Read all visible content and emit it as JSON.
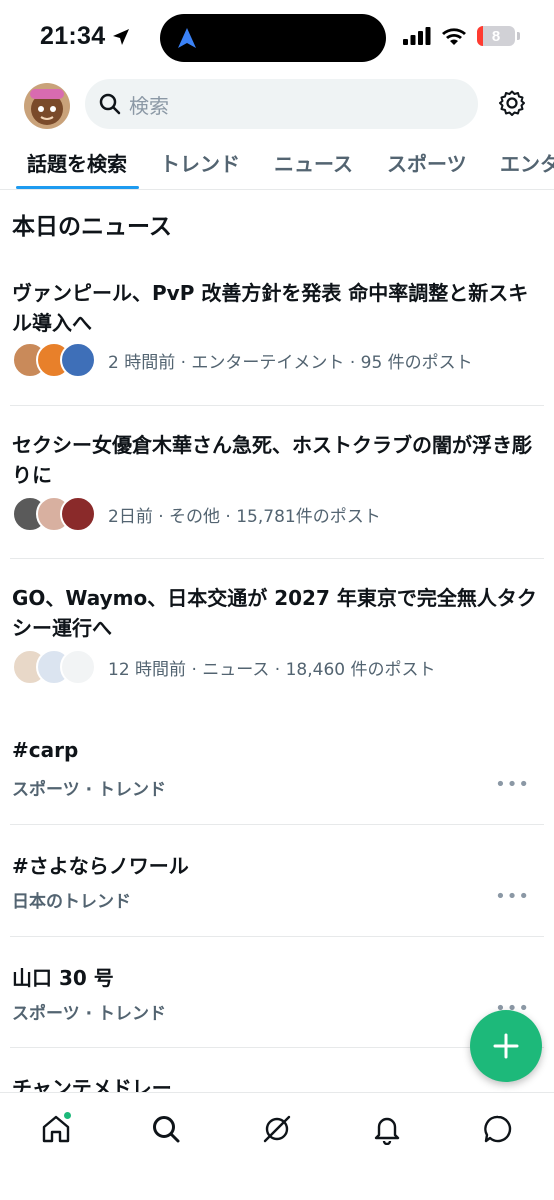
{
  "status": {
    "time": "21:34",
    "battery": "8"
  },
  "search": {
    "placeholder": "検索"
  },
  "tabs": [
    {
      "label": "話題を検索"
    },
    {
      "label": "トレンド"
    },
    {
      "label": "ニュース"
    },
    {
      "label": "スポーツ"
    },
    {
      "label": "エンタ"
    }
  ],
  "section": {
    "title": "本日のニュース"
  },
  "news": [
    {
      "headline": "ヴァンピール、PvP 改善方針を発表 命中率調整と新スキル導入へ",
      "meta": "2 時間前 · エンターテイメント · 95 件のポスト"
    },
    {
      "headline": "セクシー女優倉木華さん急死、ホストクラブの闇が浮き彫りに",
      "meta": "2日前 · その他 · 15,781件のポスト"
    },
    {
      "headline": "GO、Waymo、日本交通が 2027 年東京で完全無人タクシー運行へ",
      "meta": "12 時間前 · ニュース · 18,460 件のポスト"
    }
  ],
  "trends": [
    {
      "title": "#carp",
      "sub": "スポーツ · トレンド"
    },
    {
      "title": "#さよならノワール",
      "sub": "日本のトレンド"
    },
    {
      "title": "山口 30 号",
      "sub": "スポーツ · トレンド"
    },
    {
      "title": "チャンテメドレー",
      "sub": ""
    }
  ],
  "colors": {
    "accent": "#1d9bf0",
    "fab": "#1db97a",
    "secondary_text": "#536471"
  }
}
